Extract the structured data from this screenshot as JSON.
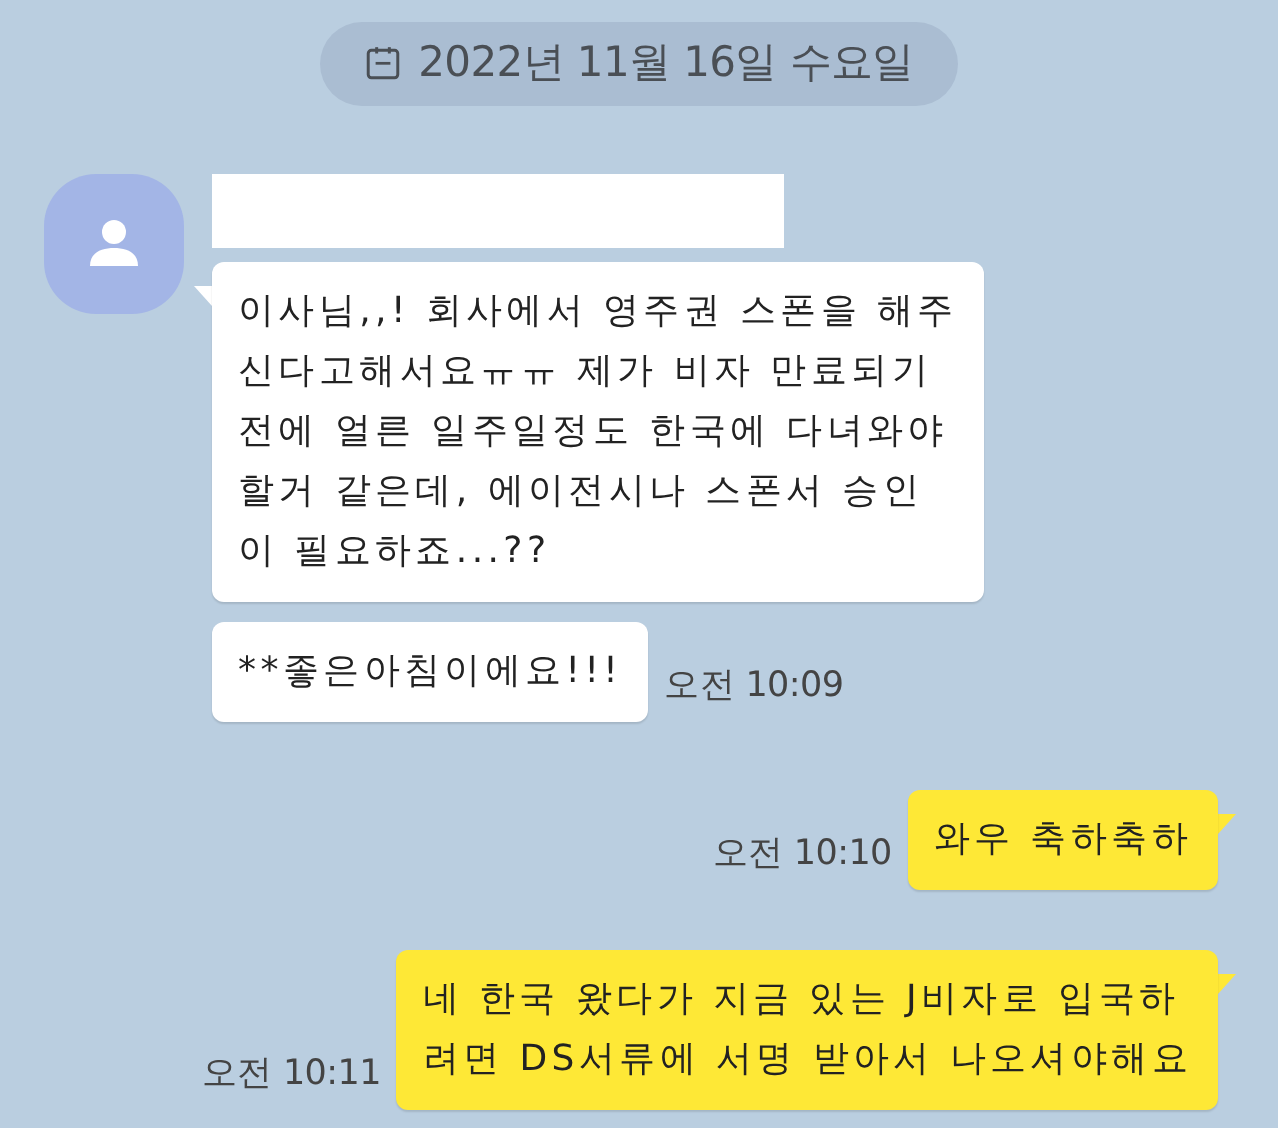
{
  "date_divider": {
    "text": "2022년 11월 16일 수요일"
  },
  "messages": [
    {
      "outgoing": false,
      "tail": true,
      "lines": [
        "이사님,,! 회사에서 영주권 스폰을 해주",
        "신다고해서요ㅠㅠ 제가 비자 만료되기",
        "전에 얼른 일주일정도 한국에 다녀와야",
        "할거 같은데, 에이전시나 스폰서 승인",
        "이 필요하죠...??"
      ]
    },
    {
      "outgoing": false,
      "tail": false,
      "lines": [
        "**좋은아침이에요!!!"
      ],
      "time": "오전 10:09"
    },
    {
      "outgoing": true,
      "tail": true,
      "lines": [
        "와우 축하축하"
      ],
      "time": "오전 10:10"
    },
    {
      "outgoing": true,
      "tail": true,
      "lines": [
        "네 한국 왔다가 지금 있는 J비자로 입국하",
        "려면 DS서류에 서명 받아서 나오셔야해요"
      ],
      "time": "오전 10:11"
    }
  ]
}
